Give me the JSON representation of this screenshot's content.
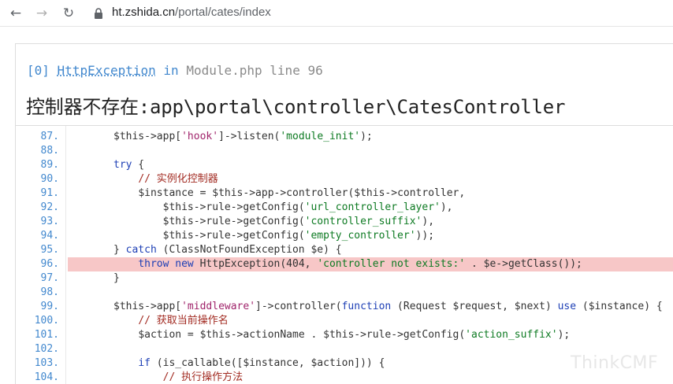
{
  "browser": {
    "back_label": "←",
    "forward_label": "→",
    "reload_label": "↻",
    "url_host": "ht.zshida.cn",
    "url_path": "/portal/cates/index"
  },
  "exception": {
    "index": "[0]",
    "class": "HttpException",
    "in_word": "in",
    "location": "Module.php line 96",
    "message": "控制器不存在:app\\portal\\controller\\CatesController"
  },
  "code_lines": [
    {
      "num": "87.",
      "text": "$this->app['hook']->listen('module_init');"
    },
    {
      "num": "88.",
      "text": ""
    },
    {
      "num": "89.",
      "text": "try {"
    },
    {
      "num": "90.",
      "text": "    // 实例化控制器"
    },
    {
      "num": "91.",
      "text": "    $instance = $this->app->controller($this->controller,"
    },
    {
      "num": "92.",
      "text": "        $this->rule->getConfig('url_controller_layer'),"
    },
    {
      "num": "93.",
      "text": "        $this->rule->getConfig('controller_suffix'),"
    },
    {
      "num": "94.",
      "text": "        $this->rule->getConfig('empty_controller'));"
    },
    {
      "num": "95.",
      "text": "} catch (ClassNotFoundException $e) {"
    },
    {
      "num": "96.",
      "text": "    throw new HttpException(404, 'controller not exists:' . $e->getClass());"
    },
    {
      "num": "97.",
      "text": "}"
    },
    {
      "num": "98.",
      "text": ""
    },
    {
      "num": "99.",
      "text": "$this->app['middleware']->controller(function (Request $request, $next) use ($instance) {"
    },
    {
      "num": "100.",
      "text": "    // 获取当前操作名"
    },
    {
      "num": "101.",
      "text": "    $action = $this->actionName . $this->rule->getConfig('action_suffix');"
    },
    {
      "num": "102.",
      "text": ""
    },
    {
      "num": "103.",
      "text": "    if (is_callable([$instance, $action])) {"
    },
    {
      "num": "104.",
      "text": "        // 执行操作方法"
    }
  ],
  "highlighted_line": "96.",
  "watermark": "ThinkCMF"
}
